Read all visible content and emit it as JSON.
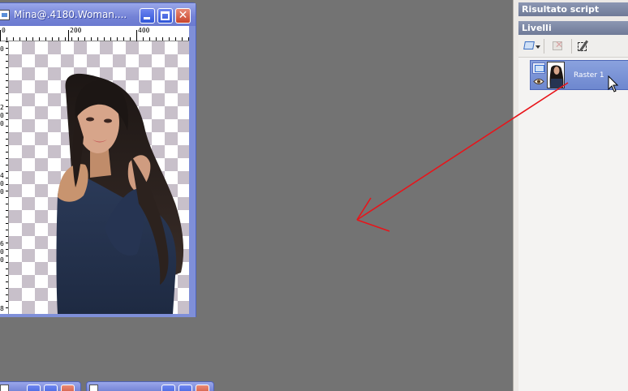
{
  "image_window": {
    "title": "Mina@.4180.Woman....",
    "ruler_h": {
      "labels": [
        "0",
        "200",
        "400"
      ]
    },
    "ruler_v": {
      "labels": [
        "0",
        "2",
        "0",
        "0",
        "4",
        "0",
        "0",
        "6",
        "0",
        "0",
        "8"
      ]
    }
  },
  "panels": {
    "script_output": {
      "title": "Risultato script"
    },
    "layers": {
      "title": "Livelli",
      "toolbar": [
        "new-layer-icon",
        "delete-layer-icon",
        "layer-properties-icon"
      ],
      "items": [
        {
          "name": "Raster 1",
          "visible": true
        }
      ]
    }
  },
  "colors": {
    "desktop": "#737373",
    "window_title": "#7382d6",
    "panel_header": "#6f7a97",
    "selected_layer": "#6d87cf",
    "annotation_arrow": "#e8141a"
  }
}
